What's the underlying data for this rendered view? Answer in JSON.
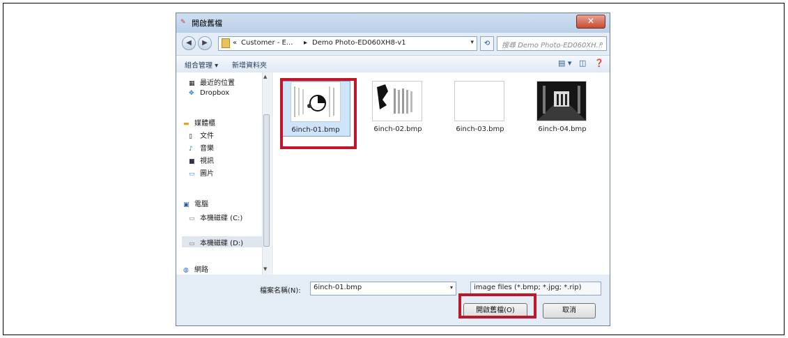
{
  "window": {
    "title": "開啟舊檔",
    "close_glyph": "✕"
  },
  "address": {
    "back_glyph": "◀",
    "forward_glyph": "▶",
    "prefix": "«",
    "crumb1": "Customer - E...",
    "separator": "▸",
    "crumb2": "Demo Photo-ED060XH8-v1",
    "dropdown_glyph": "▾",
    "refresh_glyph": "⟲",
    "search_placeholder": "搜尋 Demo Photo-ED060XH...",
    "search_glyph": "⌕"
  },
  "toolbar": {
    "organize_label": "組合管理 ▾",
    "new_folder_label": "新增資料夾",
    "view_glyph": "▤ ▾",
    "pane_glyph": "◫",
    "help_glyph": "❓"
  },
  "sidebar": {
    "items": [
      {
        "icon": "▦",
        "label": "最近的位置"
      },
      {
        "icon": "✥",
        "label": "Dropbox"
      },
      {
        "icon": "▬",
        "label": "媒體櫃"
      },
      {
        "icon": "▯",
        "label": "文件"
      },
      {
        "icon": "♪",
        "label": "音樂"
      },
      {
        "icon": "■",
        "label": "視訊"
      },
      {
        "icon": "▭",
        "label": "圖片"
      },
      {
        "icon": "▣",
        "label": "電腦"
      },
      {
        "icon": "▭",
        "label": "本機磁碟 (C:)"
      },
      {
        "icon": "▭",
        "label": "本機磁碟 (D:)"
      },
      {
        "icon": "◍",
        "label": "網路"
      }
    ]
  },
  "files": [
    {
      "name": "6inch-01.bmp"
    },
    {
      "name": "6inch-02.bmp"
    },
    {
      "name": "6inch-03.bmp"
    },
    {
      "name": "6inch-04.bmp"
    }
  ],
  "bottom": {
    "filename_label": "檔案名稱(N):",
    "filename_value": "6inch-01.bmp",
    "filetype_value": "image files (*.bmp; *.jpg; *.rip)",
    "open_label": "開啟舊檔(O)",
    "cancel_label": "取消",
    "dropdown_glyph": "▾"
  },
  "colors": {
    "highlight_red": "#c0162b",
    "selected_bg": "#cde4fb"
  }
}
